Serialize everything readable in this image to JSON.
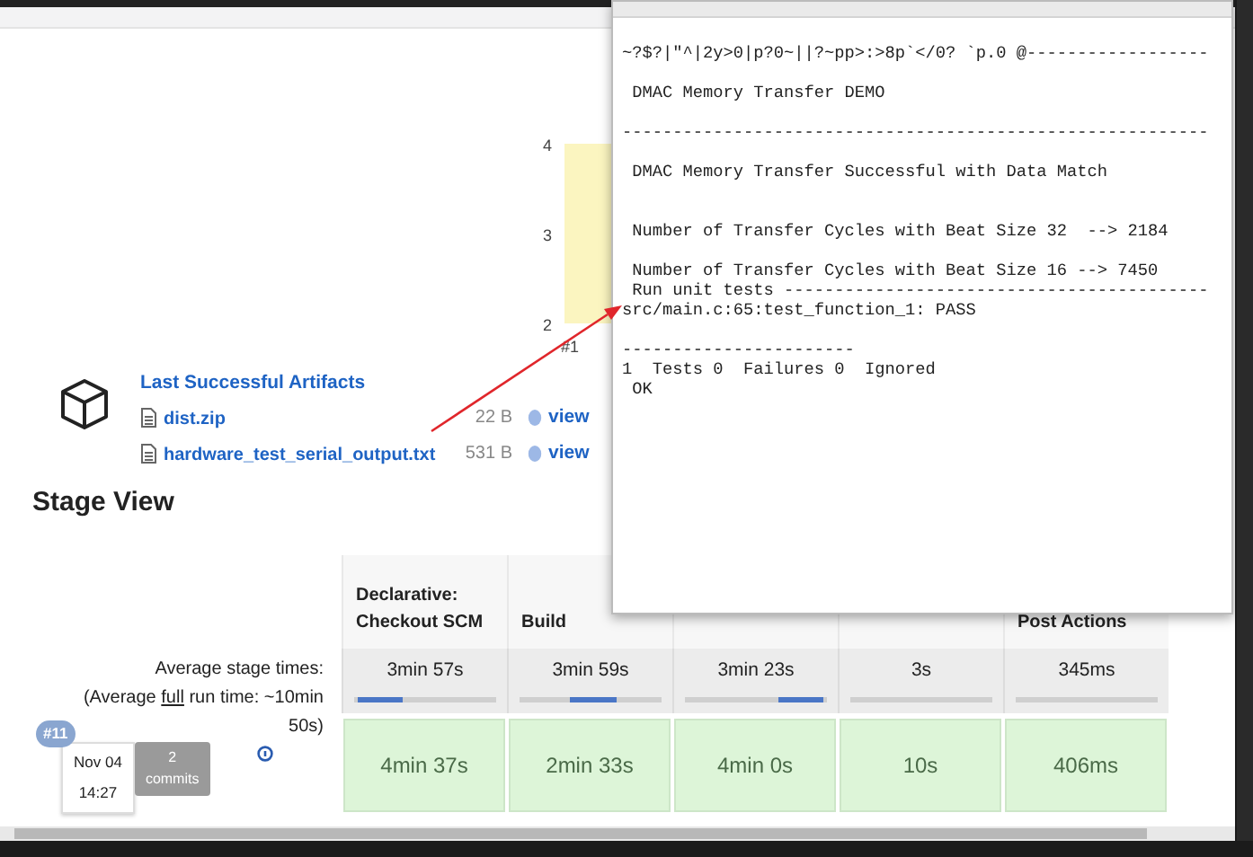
{
  "trend_chart": {
    "chart_data": {
      "type": "bar",
      "categories": [
        "#1"
      ],
      "values": [
        4
      ],
      "yticks": [
        2,
        3,
        4
      ],
      "ylim": [
        2,
        4
      ]
    }
  },
  "artifacts": {
    "title": "Last Successful Artifacts",
    "files": [
      {
        "name": "dist.zip",
        "size": "22 B",
        "action": "view"
      },
      {
        "name": "hardware_test_serial_output.txt",
        "size": "531 B",
        "action": "view"
      }
    ]
  },
  "stage_view": {
    "title": "Stage View",
    "average_label": "Average stage times:",
    "average_run_time": {
      "before": "(Average ",
      "underlined": "full",
      "after": " run time: ~10min 50s)"
    },
    "stages": [
      {
        "name": "Declarative: Checkout SCM",
        "average": "3min 57s",
        "kind": "start"
      },
      {
        "name": "Build",
        "average": "3min 59s",
        "kind": "middle"
      },
      {
        "average": "3min 23s",
        "kind": "end"
      },
      {
        "average": "3s",
        "kind": "plain"
      },
      {
        "name": "Post Actions",
        "average": "345ms",
        "kind": "plain"
      }
    ],
    "runs": [
      {
        "number": "#11",
        "date": "Nov 04",
        "time": "14:27",
        "commits_count": "2",
        "commits_label": "commits",
        "cells": [
          "4min 37s",
          "2min 33s",
          "4min 0s",
          "10s",
          "406ms"
        ]
      }
    ]
  },
  "popup_window": {
    "lines": [
      {
        "kind": "text",
        "text": "~?$?|\"^|2y>0|p?0~||?~pp>:>8p`</0? `p.0 @------------------"
      },
      {
        "kind": "blank"
      },
      {
        "kind": "text",
        "text": " DMAC Memory Transfer DEMO"
      },
      {
        "kind": "blank"
      },
      {
        "kind": "text",
        "text": "----------------------------------------------------------"
      },
      {
        "kind": "blank"
      },
      {
        "kind": "text",
        "text": " DMAC Memory Transfer Successful with Data Match"
      },
      {
        "kind": "blank"
      },
      {
        "kind": "blank"
      },
      {
        "kind": "text",
        "text": " Number of Transfer Cycles with Beat Size 32  --> 2184"
      },
      {
        "kind": "blank"
      },
      {
        "kind": "text",
        "text": " Number of Transfer Cycles with Beat Size 16 --> 7450"
      },
      {
        "kind": "text",
        "text": " Run unit tests ------------------------------------------"
      },
      {
        "kind": "text",
        "text": "src/main.c:65:test_function_1: PASS"
      },
      {
        "kind": "blank"
      },
      {
        "kind": "text",
        "text": "-----------------------"
      },
      {
        "kind": "text",
        "text": "1  Tests 0  Failures 0  Ignored"
      },
      {
        "kind": "text",
        "text": " OK"
      }
    ]
  }
}
